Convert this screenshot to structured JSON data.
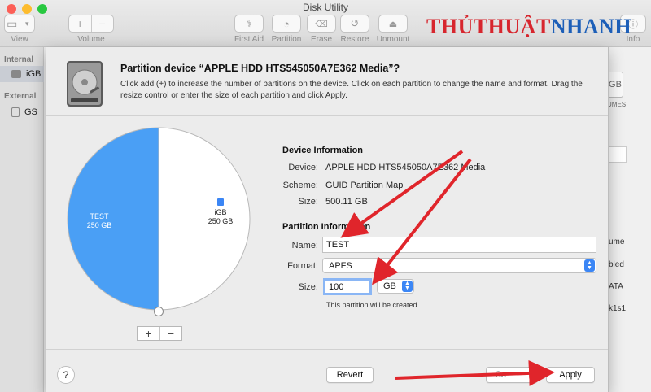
{
  "window": {
    "title": "Disk Utility"
  },
  "toolbar": {
    "view_label": "View",
    "volume_label": "Volume",
    "first_aid_label": "First Aid",
    "partition_label": "Partition",
    "erase_label": "Erase",
    "restore_label": "Restore",
    "unmount_label": "Unmount",
    "info_label": "Info",
    "volume_plus": "+",
    "volume_minus": "−"
  },
  "watermark": {
    "part1": "THỦTHUẬT",
    "part2": "NHANH"
  },
  "sidebar": {
    "internal_header": "Internal",
    "external_header": "External",
    "internal_item": "iGB",
    "external_item": "GS"
  },
  "background_fragments": {
    "gb_badge": "GB",
    "volumes": "UMES",
    "volume": "ume",
    "abled": "bled",
    "ata": "ATA",
    "disk": "k1s1",
    "cancel_partial": "Ca"
  },
  "dialog": {
    "title": "Partition device “APPLE HDD HTS545050A7E362 Media”?",
    "description": "Click add (+) to increase the number of partitions on the device. Click on each partition to change the name and format. Drag the resize control or enter the size of each partition and click Apply.",
    "device_info_header": "Device Information",
    "device_key": "Device:",
    "device_value": "APPLE HDD HTS545050A7E362 Media",
    "scheme_key": "Scheme:",
    "scheme_value": "GUID Partition Map",
    "size_key": "Size:",
    "size_value": "500.11 GB",
    "partition_info_header": "Partition Information",
    "name_key": "Name:",
    "name_value": "TEST",
    "format_key": "Format:",
    "format_value": "APFS",
    "psize_key": "Size:",
    "psize_value": "100",
    "unit_value": "GB",
    "note": "This partition will be created.",
    "add_button": "+",
    "remove_button": "−",
    "help_button": "?",
    "revert_button": "Revert",
    "apply_button": "Apply"
  },
  "pie": {
    "slices": [
      {
        "name": "TEST",
        "size": "250 GB",
        "value": 250,
        "color": "#4a9ff5"
      },
      {
        "name": "iGB",
        "size": "250 GB",
        "value": 250,
        "color": "#ffffff"
      }
    ]
  },
  "colors": {
    "accent": "#3b86f5",
    "arrow": "#e0252b",
    "watermark_red": "#d7262e",
    "watermark_blue": "#1d5fb8"
  }
}
